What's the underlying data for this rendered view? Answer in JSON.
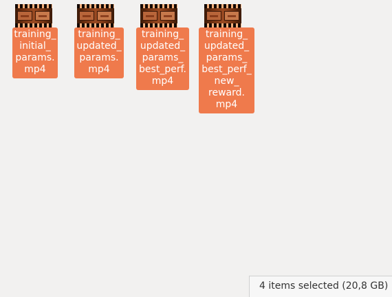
{
  "files": [
    {
      "name": "training_\ninitial_\nparams.\nmp4",
      "icon": "video-file-icon"
    },
    {
      "name": "training_\nupdated_\nparams.\nmp4",
      "icon": "video-file-icon"
    },
    {
      "name": "training_\nupdated_\nparams_\nbest_perf.\nmp4",
      "icon": "video-file-icon"
    },
    {
      "name": "training_\nupdated_\nparams_\nbest_perf_\nnew_\nreward.\nmp4",
      "icon": "video-file-icon"
    }
  ],
  "status": {
    "selection": "4 items selected  (20,8 GB)"
  },
  "colors": {
    "selection_accent": "#ef7a4c",
    "background": "#f2f1f0"
  }
}
